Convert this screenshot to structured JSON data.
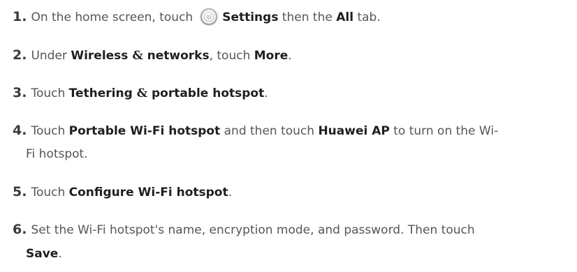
{
  "steps": [
    {
      "num": "1.",
      "pre": "On the home screen, touch",
      "b1": "Settings",
      "mid": " then the ",
      "b2": "All",
      "post": " tab."
    },
    {
      "num": "2.",
      "pre": "Under ",
      "b1a": "Wireless ",
      "amp": "&",
      "b1b": " networks",
      "mid": ", touch ",
      "b2": "More",
      "post": "."
    },
    {
      "num": "3.",
      "pre": "Touch ",
      "b1a": "Tethering ",
      "amp": "&",
      "b1b": " portable hotspot",
      "post": "."
    },
    {
      "num": "4.",
      "pre": "Touch ",
      "b1": "Portable Wi-Fi hotspot",
      "mid": " and then touch ",
      "b2": "Huawei AP",
      "post": " to turn on the Wi-",
      "cont": "Fi hotspot."
    },
    {
      "num": "5.",
      "pre": "Touch ",
      "b1": "Configure Wi-Fi hotspot",
      "post": "."
    },
    {
      "num": "6.",
      "pre": "Set the Wi-Fi hotspot's name, encryption mode, and password. Then touch",
      "cont_b": "Save",
      "cont_post": "."
    }
  ],
  "icons": {
    "settings": "settings-gear-icon"
  },
  "colors": {
    "text": "#555555",
    "bold": "#1f1f1f",
    "icon_ring": "#8a8f96",
    "icon_bg": "#c9cdd2"
  }
}
